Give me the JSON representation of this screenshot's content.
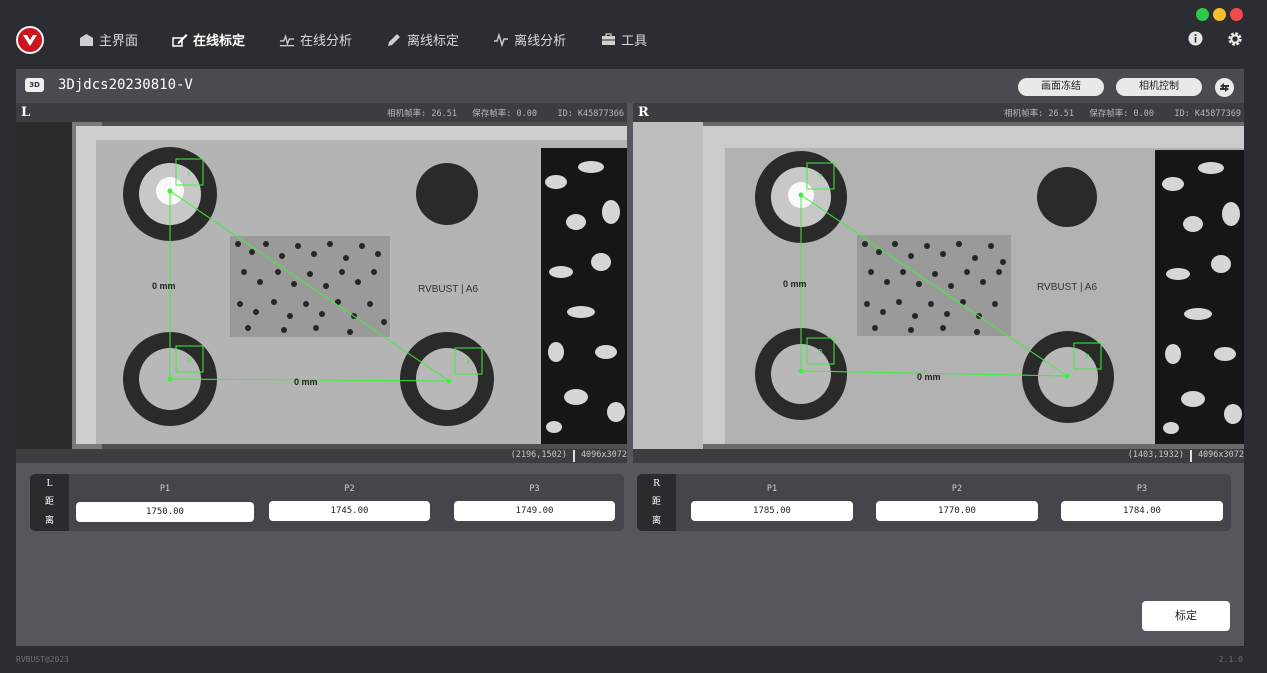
{
  "window": {
    "lights": [
      "#2ec94a",
      "#f5c028",
      "#f24a4a"
    ]
  },
  "nav": {
    "items": [
      {
        "label": "主界面",
        "icon": "home-icon"
      },
      {
        "label": "在线标定",
        "icon": "edit-icon"
      },
      {
        "label": "在线分析",
        "icon": "chart-pulse-icon"
      },
      {
        "label": "离线标定",
        "icon": "pencil-icon"
      },
      {
        "label": "离线分析",
        "icon": "pulse-icon"
      },
      {
        "label": "工具",
        "icon": "toolbox-icon"
      }
    ],
    "active_index": 1
  },
  "toolbar": {
    "tag": "3D",
    "device_name": "3Djdcs20230810-V",
    "freeze_label": "画面冻结",
    "camera_control_label": "相机控制"
  },
  "left_cam": {
    "side": "L",
    "info": "相机帧率: 26.51   保存帧率: 0.00    ID: K45877366",
    "coord": "(2196,1502)",
    "resolution": "4096x3072",
    "image_text": {
      "brand": "RVBUST | A6",
      "dist_left": "0 mm",
      "dist_bottom": "0 mm",
      "box_y": "Y",
      "box_o": "O",
      "box_x": "X"
    }
  },
  "right_cam": {
    "side": "R",
    "info": "相机帧率: 26.51   保存帧率: 0.00    ID: K45877369",
    "coord": "(1403,1932)",
    "resolution": "4096x3072",
    "image_text": {
      "brand": "RVBUST | A6",
      "dist_left": "0 mm",
      "dist_bottom": "0 mm",
      "box_y": "Y",
      "box_o": "O",
      "box_x": "X"
    }
  },
  "left_dist": {
    "side": "L",
    "label1": "距",
    "label2": "离",
    "fields": [
      {
        "name": "P1",
        "value": "1750.00"
      },
      {
        "name": "P2",
        "value": "1745.00"
      },
      {
        "name": "P3",
        "value": "1749.00"
      }
    ]
  },
  "right_dist": {
    "side": "R",
    "label1": "距",
    "label2": "离",
    "fields": [
      {
        "name": "P1",
        "value": "1785.00"
      },
      {
        "name": "P2",
        "value": "1770.00"
      },
      {
        "name": "P3",
        "value": "1784.00"
      }
    ]
  },
  "calibrate_label": "标定",
  "footer": {
    "copyright": "RVBUST@2023",
    "version": "2.1.0"
  }
}
